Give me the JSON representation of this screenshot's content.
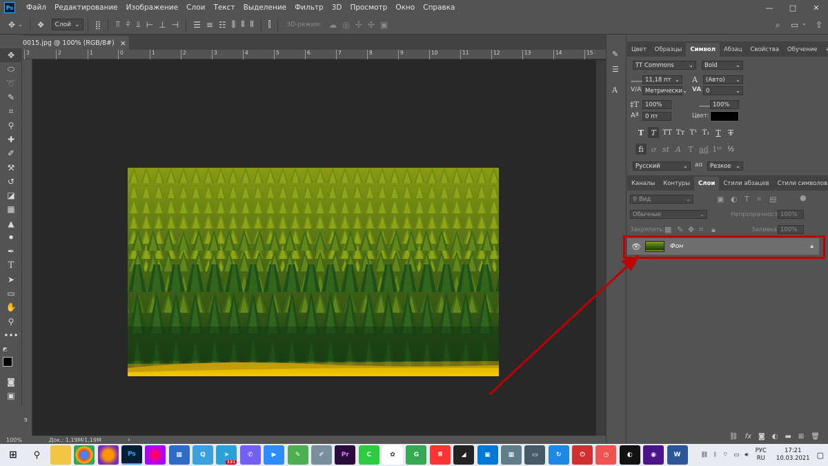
{
  "app": {
    "logo_text": "Ps",
    "menu": [
      "Файл",
      "Редактирование",
      "Изображение",
      "Слои",
      "Текст",
      "Выделение",
      "Фильтр",
      "3D",
      "Просмотр",
      "Окно",
      "Справка"
    ],
    "window_controls": {
      "minimize": "—",
      "maximize": "□",
      "close": "✕"
    }
  },
  "options_bar": {
    "layer_select": "Слой",
    "mode_3d_label": "3D-режим:"
  },
  "document": {
    "tab_title": "0015.jpg @ 100% (RGB/8#)",
    "tab_close": "×",
    "ruler_labels": [
      "3",
      "2",
      "1",
      "0",
      "1",
      "2",
      "3",
      "4",
      "5",
      "6",
      "7",
      "8",
      "9",
      "10",
      "11",
      "12",
      "13",
      "14",
      "15"
    ],
    "ruler_v_label": "9",
    "zoom": "100%",
    "doc_info": "Док.: 1,19M/1,19M",
    "status_arrow": "›"
  },
  "character_panel": {
    "tabs": [
      "Цвет",
      "Образцы",
      "Символ",
      "Абзац",
      "Свойства",
      "Обучение"
    ],
    "active_tab": "Символ",
    "font_family": "TT Commons",
    "font_style": "Bold",
    "font_size": "11,18 пт",
    "leading": "(Авто)",
    "kerning": "Метрически",
    "tracking": "0",
    "vertical_scale": "100%",
    "horizontal_scale": "100%",
    "baseline_shift": "0 пт",
    "color_label": "Цвет:",
    "color_value": "#000000",
    "language": "Русский",
    "aa_label": "aɑ",
    "antialias": "Резкое"
  },
  "layers_panel": {
    "tabs": [
      "Каналы",
      "Контуры",
      "Слои",
      "Стили абзацев",
      "Стили символов"
    ],
    "active_tab": "Слои",
    "filter_label": "Вид",
    "blend_mode": "Обычные",
    "opacity_label": "Непрозрачность:",
    "opacity_value": "100%",
    "lock_label": "Закрепить:",
    "fill_label": "Заливка:",
    "fill_value": "100%",
    "layers": [
      {
        "name": "Фон",
        "visible": true,
        "locked": true
      }
    ]
  },
  "annotation": {
    "color": "#c00000"
  },
  "taskbar": {
    "lang_top": "РУС",
    "lang_bottom": "RU",
    "time": "17:21",
    "date": "10.03.2021",
    "badge_count": "131"
  }
}
